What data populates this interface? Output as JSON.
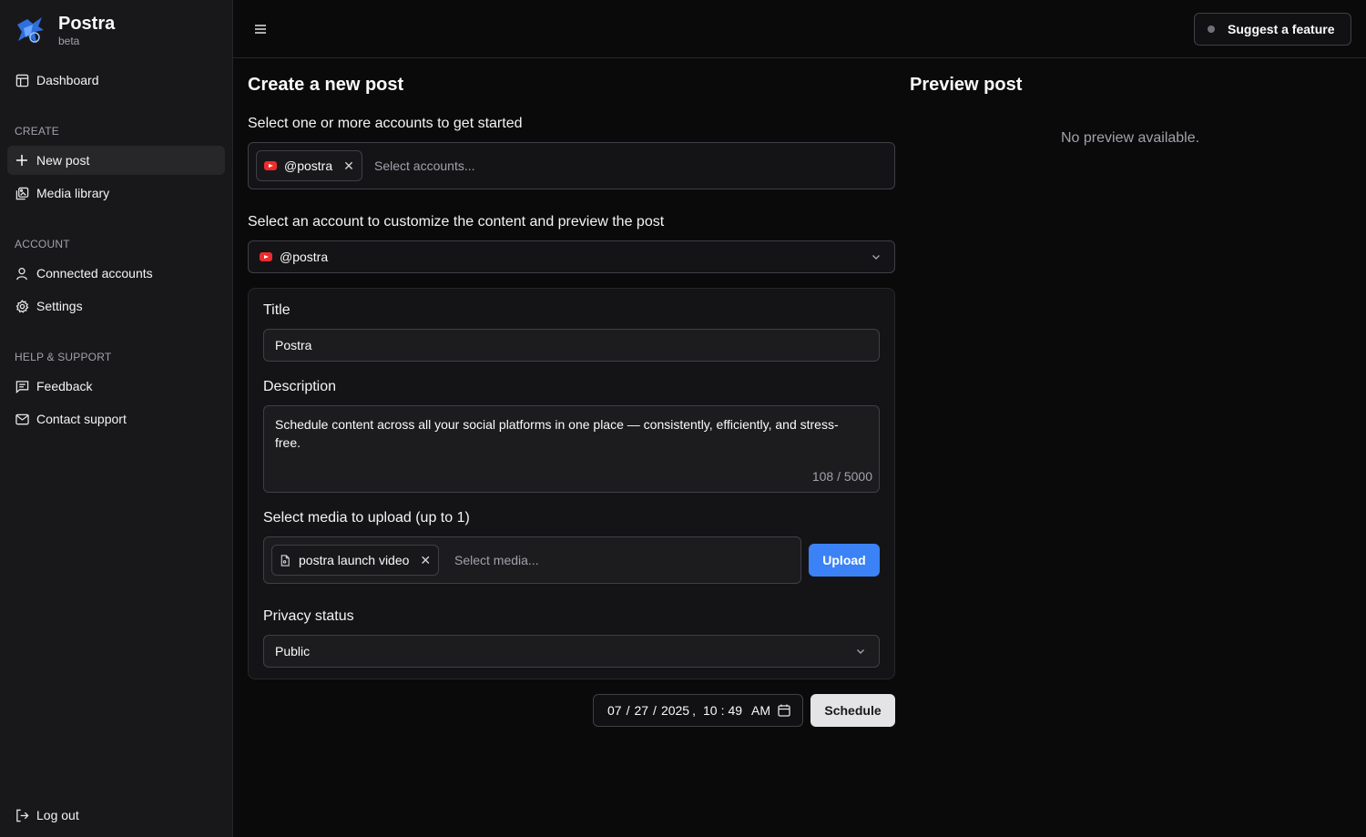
{
  "brand": {
    "name": "Postra",
    "tag": "beta"
  },
  "sidebar": {
    "dashboard": "Dashboard",
    "sections": {
      "create": "CREATE",
      "account": "ACCOUNT",
      "help": "HELP & SUPPORT"
    },
    "items": {
      "new_post": "New post",
      "media_library": "Media library",
      "connected_accounts": "Connected accounts",
      "settings": "Settings",
      "feedback": "Feedback",
      "contact_support": "Contact support"
    },
    "logout": "Log out"
  },
  "topbar": {
    "suggest_label": "Suggest a feature"
  },
  "create": {
    "heading": "Create a new post",
    "accounts_label": "Select one or more accounts to get started",
    "selected_account_chip": "@postra",
    "accounts_placeholder": "Select accounts...",
    "customize_label": "Select an account to customize the content and preview the post",
    "customize_value": "@postra",
    "title_label": "Title",
    "title_value": "Postra",
    "description_label": "Description",
    "description_value": "Schedule content across all your social platforms in one place — consistently, efficiently, and stress-free.",
    "char_count": "108 / 5000",
    "media_label": "Select media to upload (up to 1)",
    "media_chip": "postra launch video",
    "media_placeholder": "Select media...",
    "upload_label": "Upload",
    "privacy_label": "Privacy status",
    "privacy_value": "Public",
    "datetime": {
      "month": "07",
      "day": "27",
      "year": "2025",
      "hour": "10",
      "minute": "49",
      "ampm": "AM"
    },
    "schedule_label": "Schedule"
  },
  "preview": {
    "heading": "Preview post",
    "empty": "No preview available."
  },
  "colors": {
    "accent": "#3b82f6",
    "youtube": "#ef2b2b",
    "background": "#0a0a0b",
    "sidebar": "#18181b"
  }
}
